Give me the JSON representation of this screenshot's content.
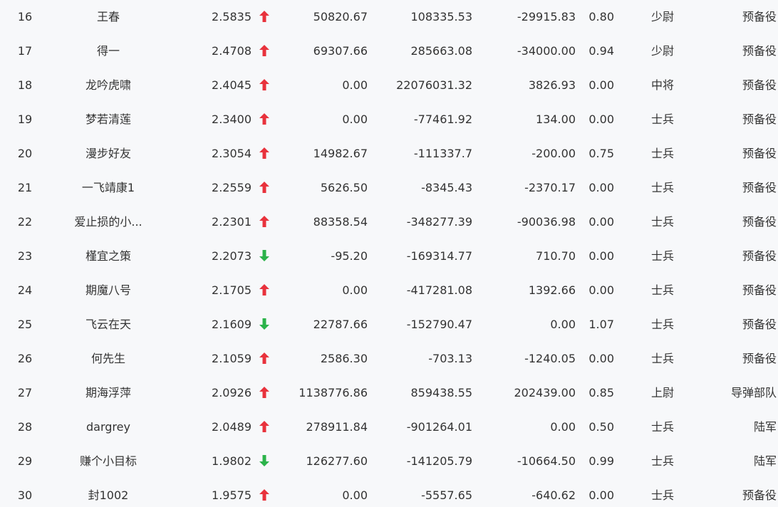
{
  "colors": {
    "up": "#e8323c",
    "down": "#2bb34a",
    "text": "#333333",
    "background": "#f7f8fa"
  },
  "rows": [
    {
      "rank": "16",
      "name": "王春",
      "score": "2.5835",
      "trend": "up",
      "v1": "50820.67",
      "v2": "108335.53",
      "v3": "-29915.83",
      "v4": "0.80",
      "title": "少尉",
      "corps": "预备役"
    },
    {
      "rank": "17",
      "name": "得一",
      "score": "2.4708",
      "trend": "up",
      "v1": "69307.66",
      "v2": "285663.08",
      "v3": "-34000.00",
      "v4": "0.94",
      "title": "少尉",
      "corps": "预备役"
    },
    {
      "rank": "18",
      "name": "龙吟虎啸",
      "score": "2.4045",
      "trend": "up",
      "v1": "0.00",
      "v2": "22076031.32",
      "v3": "3826.93",
      "v4": "0.00",
      "title": "中将",
      "corps": "预备役"
    },
    {
      "rank": "19",
      "name": "梦若清莲",
      "score": "2.3400",
      "trend": "up",
      "v1": "0.00",
      "v2": "-77461.92",
      "v3": "134.00",
      "v4": "0.00",
      "title": "士兵",
      "corps": "预备役"
    },
    {
      "rank": "20",
      "name": "漫步好友",
      "score": "2.3054",
      "trend": "up",
      "v1": "14982.67",
      "v2": "-111337.7",
      "v3": "-200.00",
      "v4": "0.75",
      "title": "士兵",
      "corps": "预备役"
    },
    {
      "rank": "21",
      "name": "一飞靖康1",
      "score": "2.2559",
      "trend": "up",
      "v1": "5626.50",
      "v2": "-8345.43",
      "v3": "-2370.17",
      "v4": "0.00",
      "title": "士兵",
      "corps": "预备役"
    },
    {
      "rank": "22",
      "name": "爱止损的小...",
      "score": "2.2301",
      "trend": "up",
      "v1": "88358.54",
      "v2": "-348277.39",
      "v3": "-90036.98",
      "v4": "0.00",
      "title": "士兵",
      "corps": "预备役"
    },
    {
      "rank": "23",
      "name": "槿宜之策",
      "score": "2.2073",
      "trend": "down",
      "v1": "-95.20",
      "v2": "-169314.77",
      "v3": "710.70",
      "v4": "0.00",
      "title": "士兵",
      "corps": "预备役"
    },
    {
      "rank": "24",
      "name": "期魔八号",
      "score": "2.1705",
      "trend": "up",
      "v1": "0.00",
      "v2": "-417281.08",
      "v3": "1392.66",
      "v4": "0.00",
      "title": "士兵",
      "corps": "预备役"
    },
    {
      "rank": "25",
      "name": "飞云在天",
      "score": "2.1609",
      "trend": "down",
      "v1": "22787.66",
      "v2": "-152790.47",
      "v3": "0.00",
      "v4": "1.07",
      "title": "士兵",
      "corps": "预备役"
    },
    {
      "rank": "26",
      "name": "何先生",
      "score": "2.1059",
      "trend": "up",
      "v1": "2586.30",
      "v2": "-703.13",
      "v3": "-1240.05",
      "v4": "0.00",
      "title": "士兵",
      "corps": "预备役"
    },
    {
      "rank": "27",
      "name": "期海浮萍",
      "score": "2.0926",
      "trend": "up",
      "v1": "1138776.86",
      "v2": "859438.55",
      "v3": "202439.00",
      "v4": "0.85",
      "title": "上尉",
      "corps": "导弹部队"
    },
    {
      "rank": "28",
      "name": "dargrey",
      "score": "2.0489",
      "trend": "up",
      "v1": "278911.84",
      "v2": "-901264.01",
      "v3": "0.00",
      "v4": "0.50",
      "title": "士兵",
      "corps": "陆军"
    },
    {
      "rank": "29",
      "name": "赚个小目标",
      "score": "1.9802",
      "trend": "down",
      "v1": "126277.60",
      "v2": "-141205.79",
      "v3": "-10664.50",
      "v4": "0.99",
      "title": "士兵",
      "corps": "陆军"
    },
    {
      "rank": "30",
      "name": "封1002",
      "score": "1.9575",
      "trend": "up",
      "v1": "0.00",
      "v2": "-5557.65",
      "v3": "-640.62",
      "v4": "0.00",
      "title": "士兵",
      "corps": "预备役"
    }
  ]
}
